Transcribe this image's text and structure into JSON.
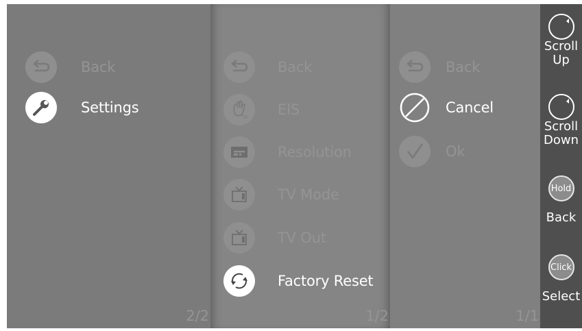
{
  "panel_settings": {
    "items": [
      {
        "label": "Back",
        "icon": "back-arrow-icon",
        "state": "dim"
      },
      {
        "label": "Settings",
        "icon": "wrench-icon",
        "state": "selected"
      }
    ],
    "page": "2/2"
  },
  "panel_menu": {
    "items": [
      {
        "label": "Back",
        "icon": "back-arrow-icon",
        "state": "dim"
      },
      {
        "label": "EIS",
        "icon": "eis-hand-icon",
        "state": "dim"
      },
      {
        "label": "Resolution",
        "icon": "resolution-icon",
        "state": "dim"
      },
      {
        "label": "TV Mode",
        "icon": "tv-icon",
        "state": "dim"
      },
      {
        "label": "TV Out",
        "icon": "tv-icon",
        "state": "dim"
      },
      {
        "label": "Factory Reset",
        "icon": "refresh-icon",
        "state": "selected"
      }
    ],
    "page": "1/2"
  },
  "panel_confirm": {
    "items": [
      {
        "label": "Back",
        "icon": "back-arrow-icon",
        "state": "dim"
      },
      {
        "label": "Cancel",
        "icon": "cancel-icon",
        "state": "selected"
      },
      {
        "label": "Ok",
        "icon": "checkmark-icon",
        "state": "dim"
      }
    ],
    "page": "1/1"
  },
  "sidebar": {
    "scroll_up": {
      "line1": "Scroll",
      "line2": "Up",
      "icon": "rotate-icon"
    },
    "scroll_down": {
      "line1": "Scroll",
      "line2": "Down",
      "icon": "rotate-icon"
    },
    "hold": {
      "icon_text": "Hold",
      "label": "Back"
    },
    "click": {
      "icon_text": "Click",
      "label": "Select"
    }
  },
  "colors": {
    "panel_bg": "#7b7b7b",
    "dim_text": "#949494",
    "selected_text": "#ffffff",
    "sidebar_bg": "#4f4f4f"
  }
}
